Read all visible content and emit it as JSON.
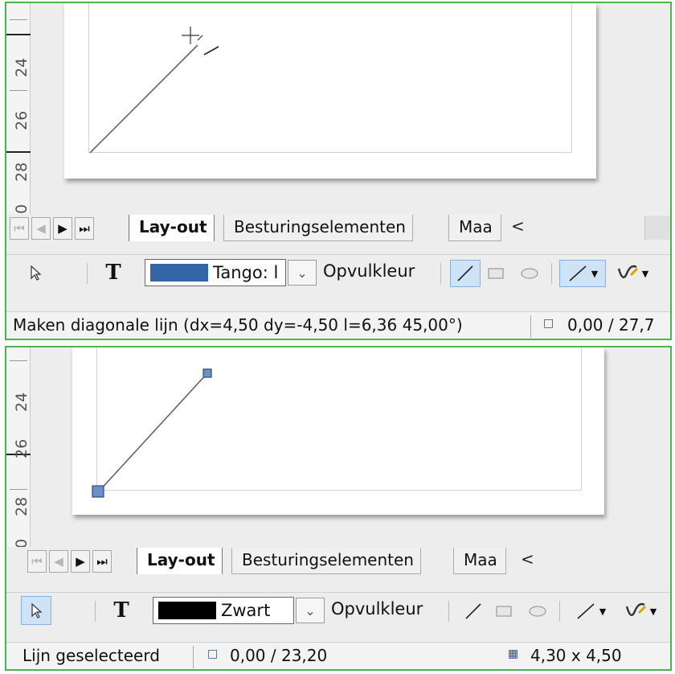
{
  "ruler": {
    "top_labels": [
      "24",
      "26",
      "28",
      "0"
    ],
    "bottom_labels": [
      "24",
      "26",
      "28",
      "0"
    ]
  },
  "tabs": {
    "nav_icons": [
      "first-sheet-icon",
      "previous-sheet-icon",
      "next-sheet-icon",
      "last-sheet-icon"
    ],
    "items": [
      "Lay-out",
      "Besturingselementen",
      "Maa"
    ],
    "scroll_left": "<"
  },
  "top": {
    "toolbar": {
      "select_icon": "pointer-icon",
      "text_icon": "T",
      "color_name": "Tango: l",
      "color_hex": "#3465a4",
      "fill_label": "Opvulkleur"
    },
    "status": {
      "message": "Maken diagonale lijn (dx=4,50 dy=-4,50  l=6,36 45,00°)",
      "position": "0,00 / 27,7"
    }
  },
  "bottom": {
    "toolbar": {
      "select_icon": "pointer-icon",
      "text_icon": "T",
      "color_name": "Zwart",
      "color_hex": "#000000",
      "fill_label": "Opvulkleur"
    },
    "status": {
      "message": "Lijn geselecteerd",
      "position": "0,00 / 23,20",
      "size": "4,30 x 4,50"
    }
  },
  "colors": {
    "frame_border": "#4bb54b",
    "selection_blue": "#cfe3f7",
    "handle_blue": "#6f8fc8"
  }
}
